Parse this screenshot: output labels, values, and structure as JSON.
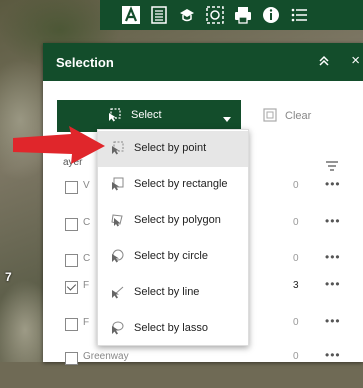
{
  "map": {
    "label": "7"
  },
  "toolbar": {
    "buttons": [
      {
        "name": "basemap-icon"
      },
      {
        "name": "layers-icon"
      },
      {
        "name": "legend-icon"
      },
      {
        "name": "select-tool-icon"
      },
      {
        "name": "print-icon"
      },
      {
        "name": "info-icon"
      },
      {
        "name": "list-icon"
      }
    ]
  },
  "panel": {
    "title": "Selection",
    "collapse_glyph": "≈",
    "close_glyph": "×",
    "select_label": "Select",
    "clear_label": "Clear",
    "layer_header": "ayer",
    "rows": [
      {
        "name": "V",
        "count": "0",
        "checked": false,
        "count_dark": false
      },
      {
        "name": "C",
        "count": "0",
        "checked": false,
        "count_dark": false
      },
      {
        "name": "C",
        "count": "0",
        "checked": false,
        "count_dark": false
      },
      {
        "name": "F",
        "count": "3",
        "checked": true,
        "count_dark": true
      },
      {
        "name": "F",
        "count": "0",
        "checked": false,
        "count_dark": false
      },
      {
        "name": "Greenway",
        "count": "0",
        "checked": false,
        "count_dark": false
      }
    ]
  },
  "menu": {
    "items": [
      {
        "label": "Select by point",
        "highlighted": true
      },
      {
        "label": "Select by rectangle",
        "highlighted": false
      },
      {
        "label": "Select by polygon",
        "highlighted": false
      },
      {
        "label": "Select by circle",
        "highlighted": false
      },
      {
        "label": "Select by line",
        "highlighted": false
      },
      {
        "label": "Select by lasso",
        "highlighted": false
      }
    ]
  },
  "colors": {
    "header_green": "#134d2b",
    "arrow_red": "#e0262b",
    "menu_highlight": "#e6e6e6"
  }
}
